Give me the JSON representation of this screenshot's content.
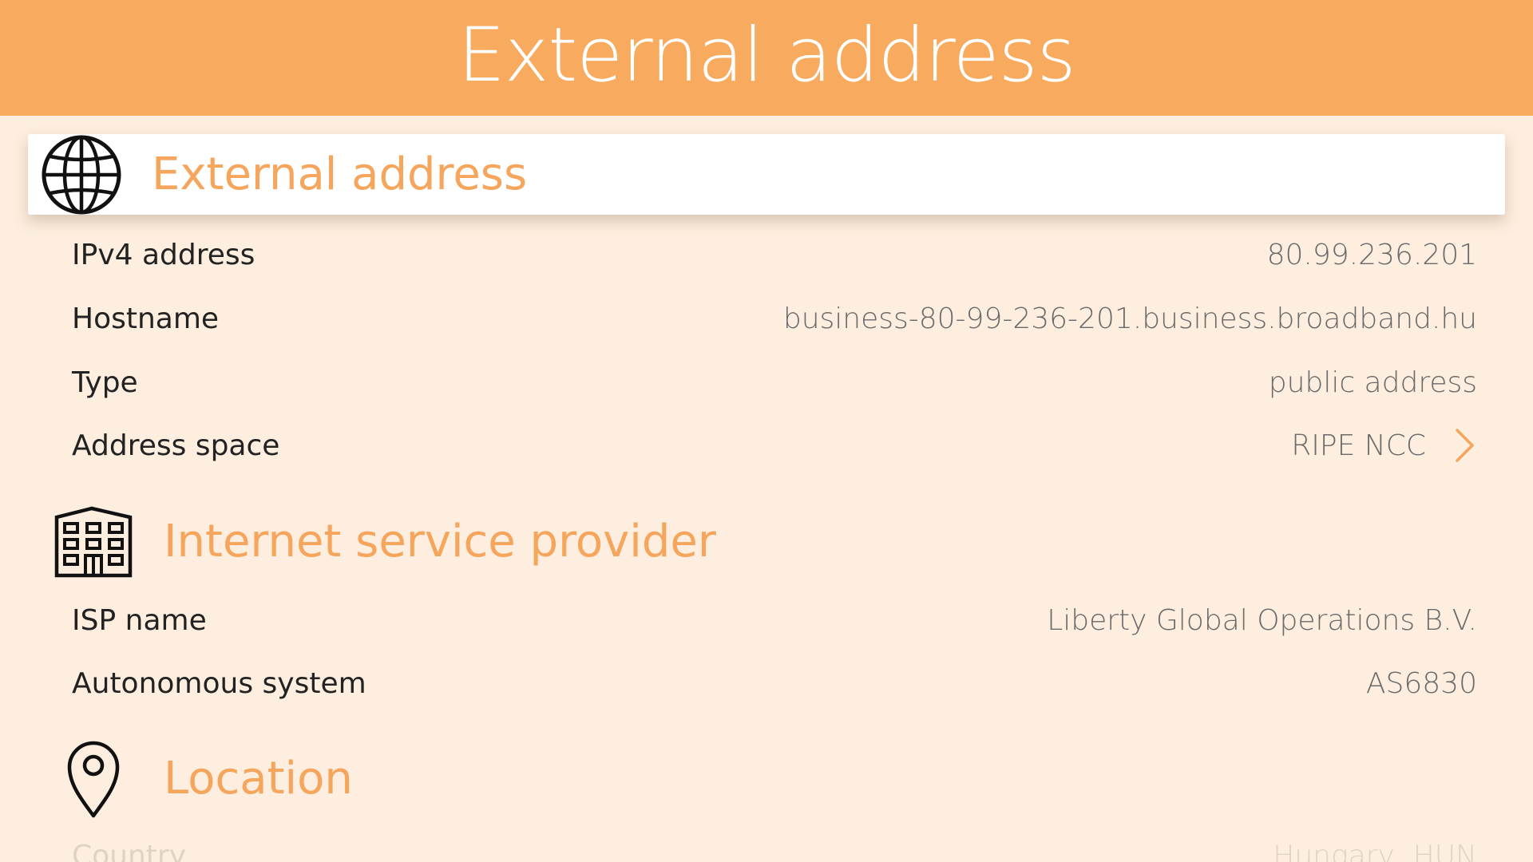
{
  "header": {
    "title": "External address"
  },
  "sections": {
    "external": {
      "title": "External address",
      "icon": "globe-icon",
      "rows": [
        {
          "label": "IPv4 address",
          "value": "80.99.236.201"
        },
        {
          "label": "Hostname",
          "value": "business-80-99-236-201.business.broadband.hu"
        },
        {
          "label": "Type",
          "value": "public address"
        },
        {
          "label": "Address space",
          "value": "RIPE NCC"
        }
      ]
    },
    "isp": {
      "title": "Internet service provider",
      "icon": "building-icon",
      "rows": [
        {
          "label": "ISP name",
          "value": "Liberty Global Operations B.V."
        },
        {
          "label": "Autonomous system",
          "value": "AS6830"
        }
      ]
    },
    "location": {
      "title": "Location",
      "icon": "map-pin-icon",
      "rows": [
        {
          "label": "Country",
          "value": "Hungary, HUN"
        }
      ]
    }
  },
  "colors": {
    "header_bg": "#f8ab5e",
    "page_bg": "#fdeedf",
    "accent_text": "#f5a55c",
    "label_text": "#222222",
    "value_text": "#6a6a6a"
  }
}
